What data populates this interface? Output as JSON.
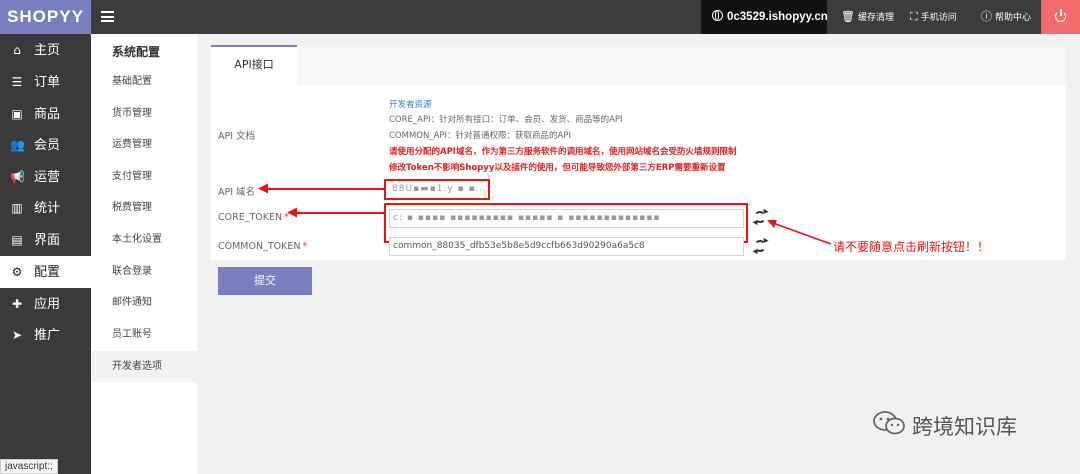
{
  "app": {
    "logo": "SHOPYY"
  },
  "topbar": {
    "domain": "0c3529.ishopyy.cn",
    "cache_clear": "缓存清理",
    "mobile_access": "手机访问",
    "help_center": "帮助中心"
  },
  "nav": {
    "items": [
      {
        "label": "主页",
        "icon": "home-icon"
      },
      {
        "label": "订单",
        "icon": "order-icon"
      },
      {
        "label": "商品",
        "icon": "box-icon"
      },
      {
        "label": "会员",
        "icon": "users-icon"
      },
      {
        "label": "运营",
        "icon": "megaphone-icon"
      },
      {
        "label": "统计",
        "icon": "bar-chart-icon"
      },
      {
        "label": "界面",
        "icon": "layout-icon"
      },
      {
        "label": "配置",
        "icon": "gear-icon",
        "active": true
      },
      {
        "label": "应用",
        "icon": "puzzle-icon"
      },
      {
        "label": "推广",
        "icon": "send-icon"
      }
    ]
  },
  "subnav": {
    "title": "系统配置",
    "items": [
      {
        "label": "基础配置"
      },
      {
        "label": "货币管理"
      },
      {
        "label": "运费管理"
      },
      {
        "label": "支付管理"
      },
      {
        "label": "税费管理"
      },
      {
        "label": "本土化设置"
      },
      {
        "label": "联合登录"
      },
      {
        "label": "邮件通知"
      },
      {
        "label": "员工账号"
      },
      {
        "label": "开发者选项",
        "active": true
      }
    ]
  },
  "tab": {
    "label": "API接口"
  },
  "form": {
    "api_doc_label": "API 文档",
    "doc_link": "开发者资源",
    "doc_core": "CORE_API：针对所有接口：订单、会员、发货、商品等的API",
    "doc_common": "COMMON_API：针对普通权限：获取商品的API",
    "doc_warn1": "请使用分配的API域名，作为第三方服务软件的调用域名，使用网站域名会受防火墙规则限制",
    "doc_warn2": "修改Token不影响Shopyy以及插件的使用，但可能导致您外部第三方ERP需要重新设置",
    "api_domain_label": "API 域名",
    "api_domain_value": "88U▪▬▪1.y ▪ ▪... m",
    "core_token_label": "CORE_TOKEN",
    "core_token_value": "c: ▪ ▪▪▪▪ ▪▪▪▪▪▪▪▪▪ ▪▪▪▪▪ ▪ ▪▪▪▪▪▪▪▪▪▪▪▪▪",
    "common_token_label": "COMMON_TOKEN",
    "common_token_value": "common_88035_dfb53e5b8e5d9ccfb663d90290a6a5c8",
    "required_mark": "*",
    "submit": "提交"
  },
  "annotation": {
    "note": "请不要随意点击刷新按钮！！"
  },
  "status_bar": "javascript:;",
  "watermark": "跨境知识库",
  "colors": {
    "brand": "#7a7fbf",
    "danger": "#e11111",
    "power": "#f26b6b"
  }
}
